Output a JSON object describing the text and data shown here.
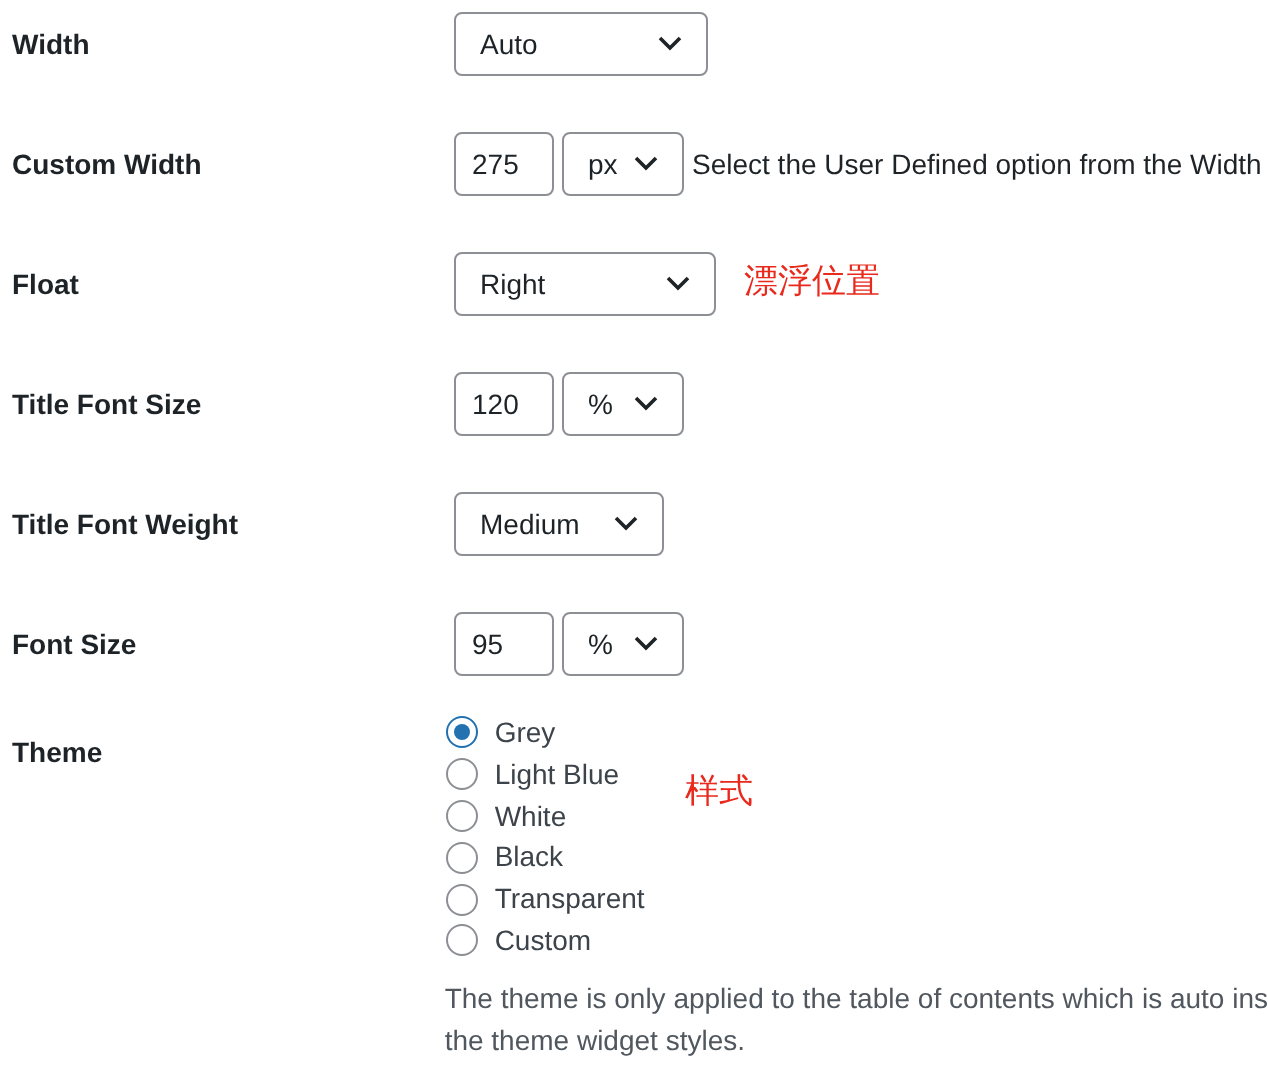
{
  "rows": [
    {
      "label": "Width",
      "kind": "select",
      "select": "Auto"
    },
    {
      "label": "Custom Width",
      "kind": "input_select",
      "input": "275",
      "select": "px",
      "note": "Select the User Defined option from the Width"
    },
    {
      "label": "Float",
      "kind": "select",
      "select": "Right",
      "annotation": "漂浮位置"
    },
    {
      "label": "Title Font Size",
      "kind": "input_select",
      "input": "120",
      "select": "%"
    },
    {
      "label": "Title Font Weight",
      "kind": "select",
      "select": "Medium"
    },
    {
      "label": "Font Size",
      "kind": "input_select",
      "input": "95",
      "select": "%"
    }
  ],
  "theme": {
    "label": "Theme",
    "annotation": "样式",
    "options": [
      {
        "label": "Grey",
        "selected": true
      },
      {
        "label": "Light Blue",
        "selected": false
      },
      {
        "label": "White",
        "selected": false
      },
      {
        "label": "Black",
        "selected": false
      },
      {
        "label": "Transparent",
        "selected": false
      },
      {
        "label": "Custom",
        "selected": false
      }
    ],
    "description": [
      "The theme is only applied to the table of contents which is auto ins",
      "the theme widget styles."
    ]
  }
}
